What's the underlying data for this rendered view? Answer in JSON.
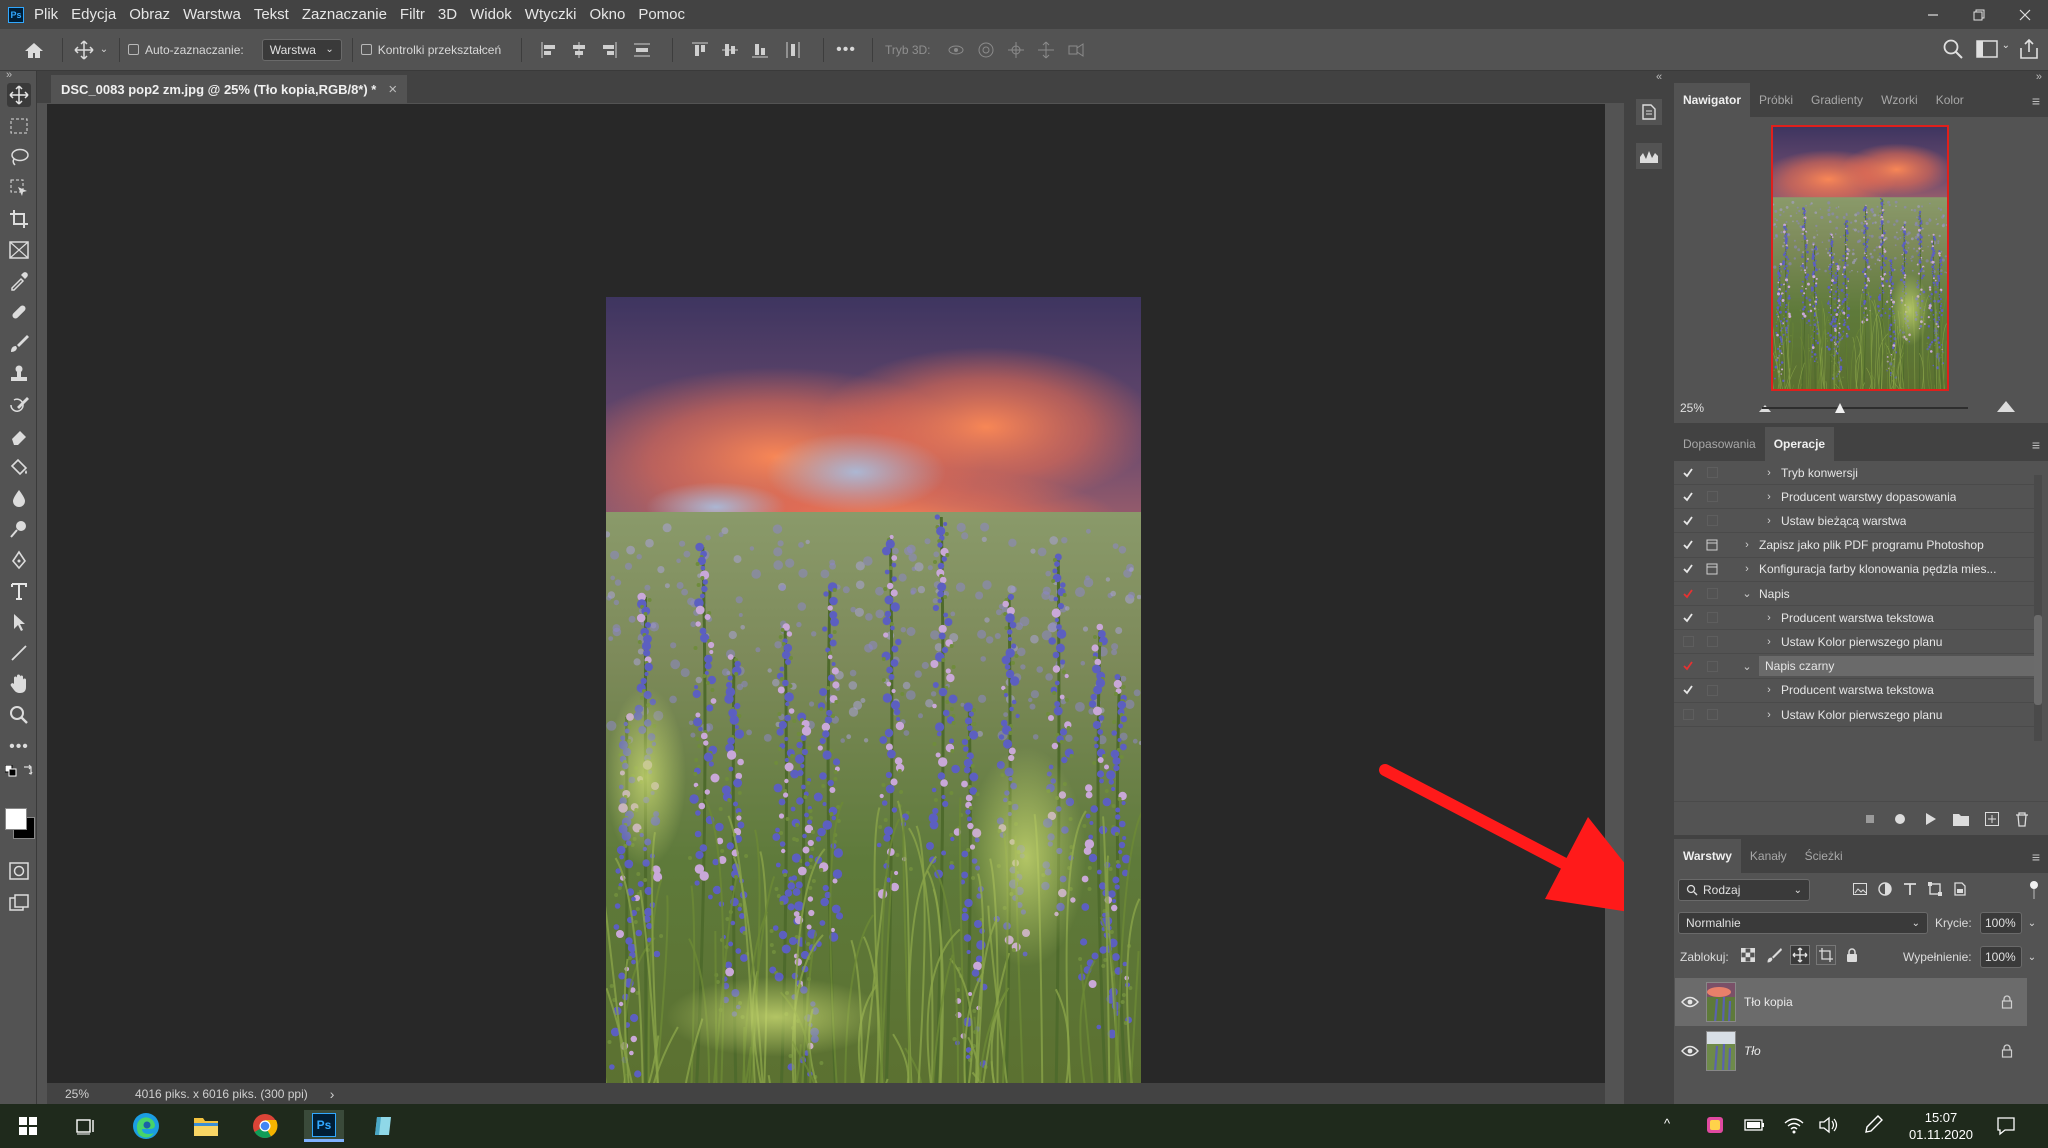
{
  "menu": {
    "app_badge": "Ps",
    "items": [
      "Plik",
      "Edycja",
      "Obraz",
      "Warstwa",
      "Tekst",
      "Zaznaczanie",
      "Filtr",
      "3D",
      "Widok",
      "Wtyczki",
      "Okno",
      "Pomoc"
    ]
  },
  "options_bar": {
    "auto_select_label": "Auto-zaznaczanie:",
    "auto_select_target": "Warstwa",
    "transform_controls_label": "Kontrolki przekształceń",
    "mode_3d_label": "Tryb 3D:",
    "more_glyph": "•••"
  },
  "document": {
    "tab_title": "DSC_0083 pop2 zm.jpg @ 25% (Tło kopia,RGB/8*) *",
    "close_glyph": "×",
    "zoom": "25%",
    "info": "4016 piks. x 6016 piks. (300 ppi)",
    "info_arrow": "›"
  },
  "navigator": {
    "tabs": [
      "Nawigator",
      "Próbki",
      "Gradienty",
      "Wzorki",
      "Kolor"
    ],
    "active_tab": "Nawigator",
    "zoom": "25%",
    "zoom_slider_fraction": 0.38
  },
  "actions": {
    "tabs": [
      "Dopasowania",
      "Operacje"
    ],
    "active_tab": "Operacje",
    "rows": [
      {
        "label": "Tryb konwersji",
        "indent": 2,
        "checked": true,
        "dialog": false,
        "arrow": "›",
        "red": false,
        "selected": false
      },
      {
        "label": "Producent warstwy dopasowania",
        "indent": 2,
        "checked": true,
        "dialog": false,
        "arrow": "›",
        "red": false,
        "selected": false
      },
      {
        "label": "Ustaw bieżącą warstwa",
        "indent": 2,
        "checked": true,
        "dialog": false,
        "arrow": "›",
        "red": false,
        "selected": false
      },
      {
        "label": "Zapisz jako plik PDF programu Photoshop",
        "indent": 1,
        "checked": true,
        "dialog": true,
        "arrow": "›",
        "red": false,
        "selected": false
      },
      {
        "label": "Konfiguracja farby klonowania pędzla mies...",
        "indent": 1,
        "checked": true,
        "dialog": true,
        "arrow": "›",
        "red": false,
        "selected": false
      },
      {
        "label": "Napis",
        "indent": 1,
        "checked": true,
        "dialog": false,
        "arrow": "⌄",
        "red": true,
        "selected": false
      },
      {
        "label": "Producent warstwa tekstowa",
        "indent": 2,
        "checked": true,
        "dialog": false,
        "arrow": "›",
        "red": false,
        "selected": false
      },
      {
        "label": "Ustaw Kolor pierwszego planu",
        "indent": 2,
        "checked": false,
        "dialog": false,
        "arrow": "›",
        "red": false,
        "selected": false
      },
      {
        "label": "Napis czarny",
        "indent": 1,
        "checked": true,
        "dialog": false,
        "arrow": "⌄",
        "red": true,
        "selected": true
      },
      {
        "label": "Producent warstwa tekstowa",
        "indent": 2,
        "checked": true,
        "dialog": false,
        "arrow": "›",
        "red": false,
        "selected": false
      },
      {
        "label": "Ustaw Kolor pierwszego planu",
        "indent": 2,
        "checked": false,
        "dialog": false,
        "arrow": "›",
        "red": false,
        "selected": false
      }
    ]
  },
  "layers": {
    "tabs": [
      "Warstwy",
      "Kanały",
      "Ścieżki"
    ],
    "active_tab": "Warstwy",
    "filter": "Rodzaj",
    "blend_mode": "Normalnie",
    "opacity_label": "Krycie:",
    "opacity": "100%",
    "lock_label": "Zablokuj:",
    "fill_label": "Wypełnienie:",
    "fill": "100%",
    "items": [
      {
        "name": "Tło kopia",
        "italic": false,
        "selected": true,
        "visible": true,
        "locked": true
      },
      {
        "name": "Tło",
        "italic": true,
        "selected": false,
        "visible": true,
        "locked": true
      }
    ]
  },
  "annotation": {
    "arrow_color": "#ff1a1a"
  },
  "taskbar": {
    "time": "15:07",
    "date": "01.11.2020",
    "ps_badge": "Ps",
    "tray_caret": "^"
  }
}
